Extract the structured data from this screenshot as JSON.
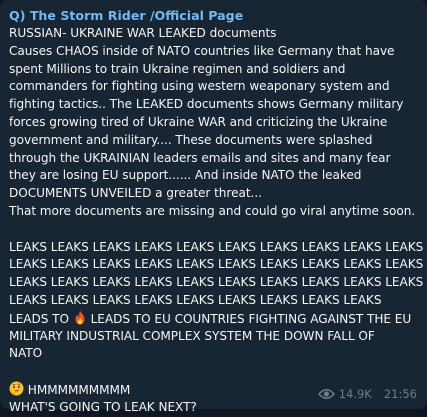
{
  "message": {
    "channel_name": "Q) The Storm Rider /Official Page",
    "lines": [
      "RUSSIAN- UKRAINE WAR LEAKED documents",
      "Causes CHAOS inside of NATO countries like Germany that have",
      "spent Millions to train Ukraine regimen and soldiers and",
      "commanders for fighting using western weaponary system and",
      "fighting tactics.. The LEAKED documents shows Germany military",
      "forces growing tired of Ukraine WAR and criticizing the Ukraine",
      "government and military.... These documents were splashed",
      "through the UKRAINIAN leaders emails and sites and many fear",
      "they are losing EU support...... And inside NATO the leaked",
      "DOCUMENTS UNVEILED a greater threat...",
      "That more documents are missing and could go viral anytime soon.",
      "",
      "LEAKS LEAKS LEAKS LEAKS LEAKS LEAKS LEAKS LEAKS LEAKS LEAKS",
      "LEAKS LEAKS LEAKS LEAKS LEAKS LEAKS LEAKS LEAKS LEAKS LEAKS",
      "LEAKS LEAKS LEAKS LEAKS LEAKS LEAKS LEAKS LEAKS LEAKS LEAKS",
      "LEAKS LEAKS LEAKS LEAKS LEAKS LEAKS LEAKS LEAKS LEAKS"
    ],
    "leads_prefix": "LEADS TO",
    "leads_emoji": "fire-emoji",
    "leads_suffix": "LEADS TO EU COUNTRIES FIGHTING AGAINST THE EU",
    "lines_after": [
      "MILITARY INDUSTRIAL COMPLEX SYSTEM THE DOWN FALL OF",
      "NATO",
      ""
    ],
    "hmm_emoji": "thinking-face-emoji",
    "hmm_text": "HMMMMMMMMM",
    "last_line": "WHAT'S GOING TO LEAK NEXT?",
    "views": "14.9K",
    "time": "21:56"
  },
  "colors": {
    "background": "#182533",
    "channel_name": "#71baf7",
    "text": "#f5f5f5",
    "meta": "#6d7f8f"
  }
}
